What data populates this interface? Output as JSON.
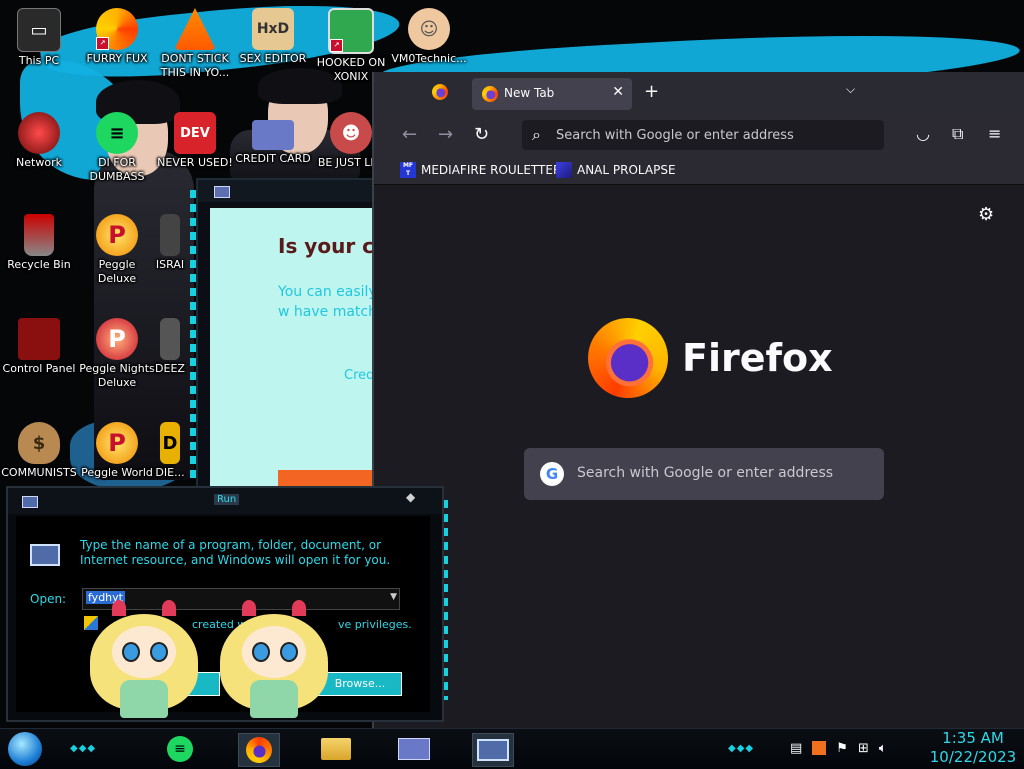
{
  "desktop": {
    "icons": [
      {
        "label": "This PC"
      },
      {
        "label": "FURRY FUX"
      },
      {
        "label": "DONT STICK THIS IN YO..."
      },
      {
        "label": "SEX EDITOR"
      },
      {
        "label": "HOOKED ON XONIX"
      },
      {
        "label": "VM0Technic..."
      },
      {
        "label": "Network"
      },
      {
        "label": "DI FOR DUMBASS"
      },
      {
        "label": "NEVER USED!"
      },
      {
        "label": "CREDIT CARD"
      },
      {
        "label": "BE JUST LI..."
      },
      {
        "label": "Recycle Bin"
      },
      {
        "label": "Peggle Deluxe"
      },
      {
        "label": "ISRAI"
      },
      {
        "label": "Control Panel"
      },
      {
        "label": "Peggle Nights Deluxe"
      },
      {
        "label": "DEEZ"
      },
      {
        "label": "COMMUNISTS"
      },
      {
        "label": "Peggle World"
      },
      {
        "label": "DIE..."
      }
    ]
  },
  "background_window": {
    "heading": "Is your cre",
    "body": "You can easily here and we w have match yo",
    "link": "Cred"
  },
  "firefox": {
    "tab_title": "New Tab",
    "new_tab_symbol": "+",
    "close_symbol": "✕",
    "tab_list_symbol": "⌵",
    "back": "←",
    "forward": "→",
    "reload": "↻",
    "url_placeholder": "Search with Google or enter address",
    "bookmarks": [
      {
        "label": "MEDIAFIRE ROULETTER",
        "favicon_text": "MF T"
      },
      {
        "label": "ANAL PROLAPSE"
      }
    ],
    "brand": "Firefox",
    "search_placeholder": "Search with Google or enter address",
    "google_glyph": "G",
    "settings_glyph": "⚙",
    "pocket_glyph": "◡",
    "extensions_glyph": "⧉",
    "menu_glyph": "≡"
  },
  "run_dialog": {
    "title": "Run",
    "description": "Type the name of a program, folder, document, or Internet resource, and Windows will open it for you.",
    "open_label": "Open:",
    "open_value": "fydhyt",
    "privilege_text_a": "created w",
    "privilege_text_b": "ve privileges.",
    "browse_label": "Browse..."
  },
  "taskbar": {
    "time": "1:35 AM",
    "date": "10/22/2023"
  },
  "colors": {
    "accent_cyan": "#2fd8e8",
    "firefox_bg": "#1c1b22",
    "taskbar_bg": "#02050a"
  }
}
